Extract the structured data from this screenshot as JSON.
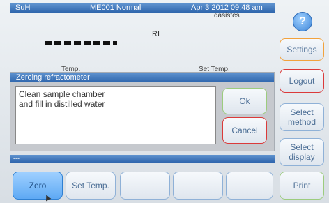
{
  "topbar": {
    "user": "SuH",
    "method_status": "ME001 Normal",
    "datetime": "Apr 3 2012 09:48 am",
    "subtitle": "dasistes"
  },
  "help_label": "?",
  "reading": {
    "label": "RI",
    "temp_label": "Temp.",
    "set_temp_label": "Set Temp."
  },
  "dialog": {
    "title": "Zeroing refractometer",
    "message_line1": "Clean sample chamber",
    "message_line2": "and fill in distilled water",
    "ok_label": "Ok",
    "cancel_label": "Cancel"
  },
  "status_text": "---",
  "sidebar": {
    "settings_label": "Settings",
    "logout_label": "Logout",
    "select_method_label": "Select method",
    "select_display_label": "Select display",
    "print_label": "Print"
  },
  "bottom_buttons": {
    "zero_label": "Zero",
    "set_temp_label": "Set Temp."
  },
  "colors": {
    "accent": "#2f66ad",
    "selected_button": "#5ea9f4",
    "warning_border": "#db3a3a",
    "settings_border": "#f2a23c",
    "ok_border": "#9ccc7e"
  }
}
